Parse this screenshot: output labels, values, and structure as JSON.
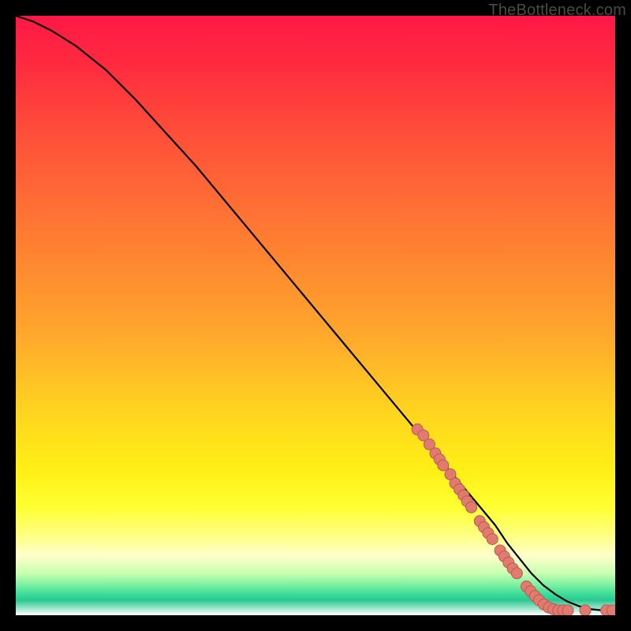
{
  "watermark": "TheBottleneck.com",
  "colors": {
    "background": "#000000",
    "curve": "#000000",
    "dot_fill": "#e27b6f",
    "dot_stroke": "#b95a52"
  },
  "chart_data": {
    "type": "line",
    "title": "",
    "xlabel": "",
    "ylabel": "",
    "xlim": [
      0,
      100
    ],
    "ylim": [
      0,
      100
    ],
    "series": [
      {
        "name": "curve",
        "x": [
          0,
          3,
          6,
          10,
          15,
          20,
          25,
          30,
          35,
          40,
          45,
          50,
          55,
          60,
          65,
          70,
          75,
          80,
          82,
          84,
          86,
          88,
          90,
          92,
          94,
          96,
          98,
          100
        ],
        "y": [
          100,
          99,
          97.5,
          95,
          91,
          86,
          80.5,
          75,
          69,
          63,
          57,
          51,
          45,
          39,
          33,
          27,
          21,
          15,
          12,
          9.5,
          7,
          5,
          3.5,
          2.3,
          1.5,
          1.0,
          0.8,
          0.8
        ]
      }
    ],
    "markers": [
      {
        "name": "highlighted-points",
        "points": [
          {
            "x": 67,
            "y": 31
          },
          {
            "x": 68,
            "y": 30
          },
          {
            "x": 69,
            "y": 28.5
          },
          {
            "x": 70,
            "y": 27
          },
          {
            "x": 70.7,
            "y": 26
          },
          {
            "x": 71.3,
            "y": 25
          },
          {
            "x": 72.5,
            "y": 23.5
          },
          {
            "x": 73.3,
            "y": 22
          },
          {
            "x": 74,
            "y": 21
          },
          {
            "x": 74.7,
            "y": 20
          },
          {
            "x": 75.3,
            "y": 19
          },
          {
            "x": 76,
            "y": 18
          },
          {
            "x": 77.4,
            "y": 15.7
          },
          {
            "x": 78.1,
            "y": 14.7
          },
          {
            "x": 78.8,
            "y": 13.7
          },
          {
            "x": 79.5,
            "y": 12.7
          },
          {
            "x": 80.8,
            "y": 10.8
          },
          {
            "x": 81.5,
            "y": 9.8
          },
          {
            "x": 82.2,
            "y": 8.8
          },
          {
            "x": 82.9,
            "y": 7.8
          },
          {
            "x": 83.6,
            "y": 7.0
          },
          {
            "x": 85.2,
            "y": 4.8
          },
          {
            "x": 85.9,
            "y": 4.0
          },
          {
            "x": 86.6,
            "y": 3.2
          },
          {
            "x": 87.3,
            "y": 2.5
          },
          {
            "x": 88.1,
            "y": 1.8
          },
          {
            "x": 88.9,
            "y": 1.3
          },
          {
            "x": 89.7,
            "y": 1.0
          },
          {
            "x": 90.5,
            "y": 0.8
          },
          {
            "x": 91.3,
            "y": 0.8
          },
          {
            "x": 92.1,
            "y": 0.8
          },
          {
            "x": 95.0,
            "y": 0.8
          },
          {
            "x": 98.5,
            "y": 0.8
          },
          {
            "x": 99.5,
            "y": 0.8
          }
        ]
      }
    ]
  }
}
